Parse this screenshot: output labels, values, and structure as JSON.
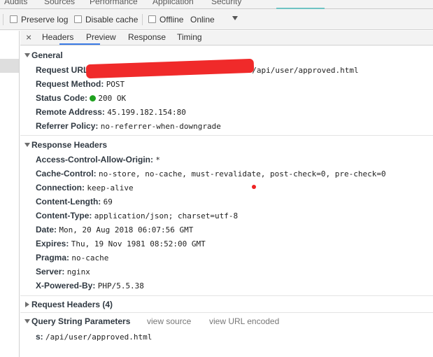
{
  "top_tabs": [
    "Audits",
    "Sources",
    "Performance",
    "Application",
    "Security"
  ],
  "toolbar": {
    "preserve_log": "Preserve log",
    "disable_cache": "Disable cache",
    "offline": "Offline",
    "throttle_value": "Online"
  },
  "subtabs": {
    "close": "×",
    "items": [
      "Headers",
      "Preview",
      "Response",
      "Timing"
    ],
    "active": "Headers"
  },
  "general": {
    "title": "General",
    "request_url_label": "Request URL:",
    "request_url_value": "=/api/user/approved.html",
    "request_method_label": "Request Method:",
    "request_method_value": "POST",
    "status_code_label": "Status Code:",
    "status_code_value": "200 OK",
    "remote_address_label": "Remote Address:",
    "remote_address_value": "45.199.182.154:80",
    "referrer_policy_label": "Referrer Policy:",
    "referrer_policy_value": "no-referrer-when-downgrade"
  },
  "response_headers": {
    "title": "Response Headers",
    "items": [
      {
        "key": "Access-Control-Allow-Origin:",
        "value": "*"
      },
      {
        "key": "Cache-Control:",
        "value": "no-store, no-cache, must-revalidate, post-check=0, pre-check=0"
      },
      {
        "key": "Connection:",
        "value": "keep-alive"
      },
      {
        "key": "Content-Length:",
        "value": "69"
      },
      {
        "key": "Content-Type:",
        "value": "application/json; charset=utf-8"
      },
      {
        "key": "Date:",
        "value": "Mon, 20 Aug 2018 06:07:56 GMT"
      },
      {
        "key": "Expires:",
        "value": "Thu, 19 Nov 1981 08:52:00 GMT"
      },
      {
        "key": "Pragma:",
        "value": "no-cache"
      },
      {
        "key": "Server:",
        "value": "nginx"
      },
      {
        "key": "X-Powered-By:",
        "value": "PHP/5.5.38"
      }
    ]
  },
  "request_headers": {
    "title": "Request Headers (4)"
  },
  "query_string": {
    "title": "Query String Parameters",
    "view_source": "view source",
    "view_url_encoded": "view URL encoded",
    "param_key": "s:",
    "param_value": "/api/user/approved.html"
  },
  "colors": {
    "status_ok": "#1fa11f",
    "redaction": "#f02a2a",
    "active_tab": "#3b7be6"
  }
}
